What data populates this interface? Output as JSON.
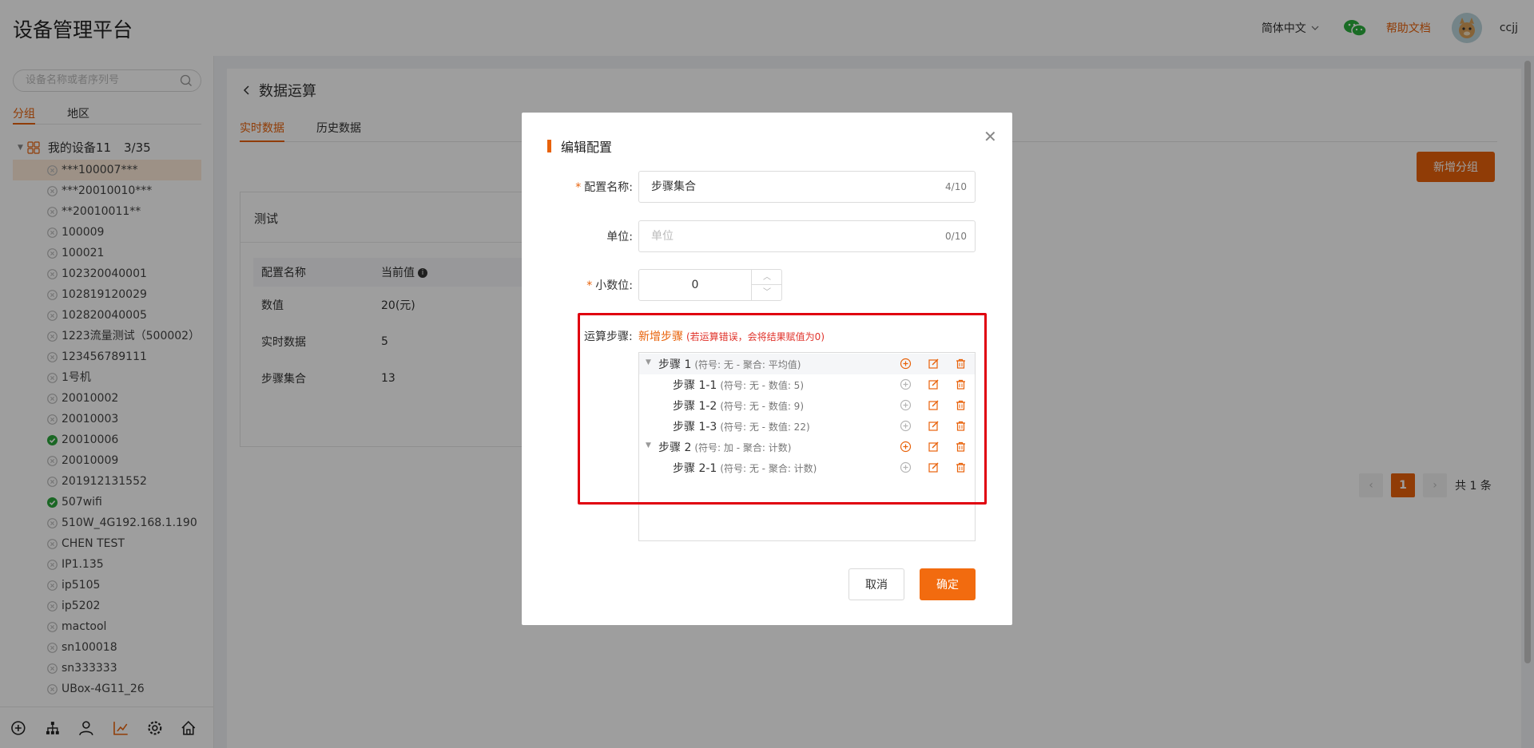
{
  "app": {
    "title": "设备管理平台"
  },
  "header": {
    "language": "简体中文",
    "help": "帮助文档",
    "username": "ccjj"
  },
  "sidebar": {
    "search_placeholder": "设备名称或者序列号",
    "tabs": [
      "分组",
      "地区"
    ],
    "group_name": "我的设备11",
    "group_count": "3/35",
    "devices": [
      {
        "name": "***100007***",
        "status": "offline",
        "selected": true
      },
      {
        "name": "***20010010***",
        "status": "offline"
      },
      {
        "name": "**20010011**",
        "status": "offline"
      },
      {
        "name": "100009",
        "status": "offline"
      },
      {
        "name": "100021",
        "status": "offline"
      },
      {
        "name": "102320040001",
        "status": "offline"
      },
      {
        "name": "102819120029",
        "status": "offline"
      },
      {
        "name": "102820040005",
        "status": "offline"
      },
      {
        "name": "1223流量测试（500002）",
        "status": "offline"
      },
      {
        "name": "123456789111",
        "status": "offline"
      },
      {
        "name": "1号机",
        "status": "offline"
      },
      {
        "name": "20010002",
        "status": "offline"
      },
      {
        "name": "20010003",
        "status": "offline"
      },
      {
        "name": "20010006",
        "status": "online"
      },
      {
        "name": "20010009",
        "status": "offline"
      },
      {
        "name": "201912131552",
        "status": "offline"
      },
      {
        "name": "507wifi",
        "status": "online"
      },
      {
        "name": "510W_4G192.168.1.190",
        "status": "offline"
      },
      {
        "name": "CHEN TEST",
        "status": "offline"
      },
      {
        "name": "IP1.135",
        "status": "offline"
      },
      {
        "name": "ip5105",
        "status": "offline"
      },
      {
        "name": "ip5202",
        "status": "offline"
      },
      {
        "name": "mactool",
        "status": "offline"
      },
      {
        "name": "sn100018",
        "status": "offline"
      },
      {
        "name": "sn333333",
        "status": "offline"
      },
      {
        "name": "UBox-4G11_26",
        "status": "offline"
      }
    ],
    "bottom_icons": [
      "plus-circle-icon",
      "sitemap-icon",
      "user-icon",
      "chart-icon",
      "settings-icon",
      "home-icon"
    ]
  },
  "main": {
    "title": "数据运算",
    "tabs": [
      "实时数据",
      "历史数据"
    ],
    "add_group_button": "新增分组",
    "card_title": "测试",
    "table": {
      "headers": [
        "配置名称",
        "当前值"
      ],
      "rows": [
        [
          "数值",
          "20(元)"
        ],
        [
          "实时数据",
          "5"
        ],
        [
          "步骤集合",
          "13"
        ]
      ]
    },
    "pagination": {
      "current": "1",
      "total": "共 1 条"
    }
  },
  "modal": {
    "title": "编辑配置",
    "config_name_label": "配置名称:",
    "config_name_value": "步骤集合",
    "config_name_count": "4/10",
    "unit_label": "单位:",
    "unit_placeholder": "单位",
    "unit_count": "0/10",
    "decimal_label": "小数位:",
    "decimal_value": "0",
    "steps_label": "运算步骤:",
    "add_step": "新增步骤",
    "add_step_note": "(若运算错误，会将结果赋值为0)",
    "steps": [
      {
        "name": "步骤 1",
        "meta": "(符号: 无 - 聚合: 平均值)",
        "level": 0,
        "expandable": true
      },
      {
        "name": "步骤 1-1",
        "meta": "(符号: 无 - 数值: 5)",
        "level": 1
      },
      {
        "name": "步骤 1-2",
        "meta": "(符号: 无 - 数值: 9)",
        "level": 1
      },
      {
        "name": "步骤 1-3",
        "meta": "(符号: 无 - 数值: 22)",
        "level": 1
      },
      {
        "name": "步骤 2",
        "meta": "(符号: 加 - 聚合: 计数)",
        "level": 0,
        "expandable": true
      },
      {
        "name": "步骤 2-1",
        "meta": "(符号: 无 - 聚合: 计数)",
        "level": 1
      }
    ],
    "cancel": "取消",
    "confirm": "确定"
  },
  "colors": {
    "accent": "#e8620a",
    "highlight_frame": "#e0000f",
    "online": "#2aa63b",
    "offline": "#bbbbbb"
  }
}
